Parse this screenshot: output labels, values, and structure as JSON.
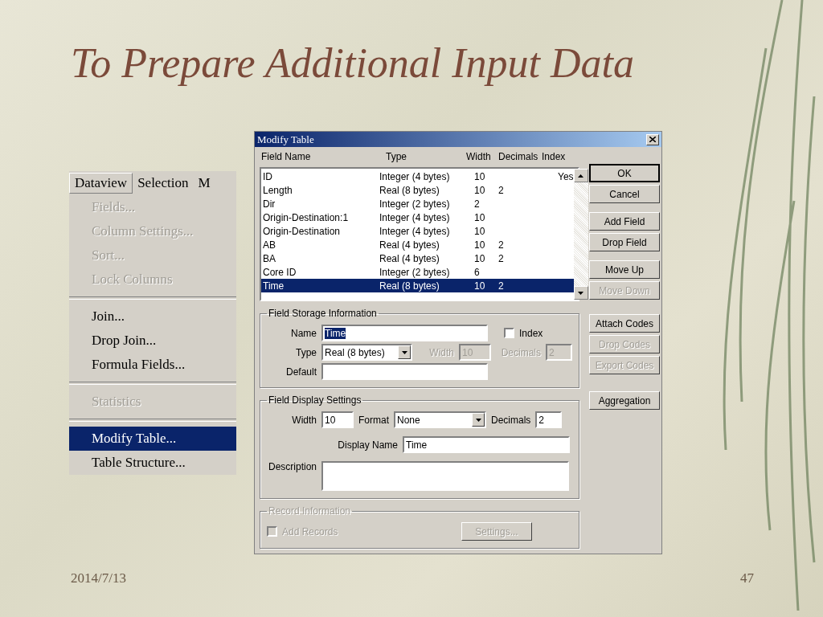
{
  "slide": {
    "title": "To Prepare Additional Input Data",
    "date": "2014/7/13",
    "page_number": "47"
  },
  "menu": {
    "menu_bar": [
      {
        "label": "Dataview",
        "selected": true
      },
      {
        "label": "Selection",
        "selected": false
      },
      {
        "label": "M",
        "selected": false
      }
    ],
    "items": [
      {
        "kind": "item",
        "label": "Fields...",
        "disabled": true,
        "selected": false
      },
      {
        "kind": "item",
        "label": "Column Settings...",
        "disabled": true,
        "selected": false
      },
      {
        "kind": "item",
        "label": "Sort...",
        "disabled": true,
        "selected": false
      },
      {
        "kind": "item",
        "label": "Lock Columns",
        "disabled": true,
        "selected": false
      },
      {
        "kind": "separator"
      },
      {
        "kind": "item",
        "label": "Join...",
        "disabled": false,
        "selected": false
      },
      {
        "kind": "item",
        "label": "Drop Join...",
        "disabled": false,
        "selected": false
      },
      {
        "kind": "item",
        "label": "Formula Fields...",
        "disabled": false,
        "selected": false
      },
      {
        "kind": "separator"
      },
      {
        "kind": "item",
        "label": "Statistics",
        "disabled": true,
        "selected": false
      },
      {
        "kind": "separator"
      },
      {
        "kind": "item",
        "label": "Modify Table...",
        "disabled": false,
        "selected": true
      },
      {
        "kind": "item",
        "label": "Table Structure...",
        "disabled": false,
        "selected": false
      }
    ]
  },
  "dialog": {
    "title": "Modify Table",
    "columns": [
      "Field Name",
      "Type",
      "Width",
      "Decimals",
      "Index"
    ],
    "rows": [
      {
        "cells": [
          "ID",
          "Integer (4 bytes)",
          "10",
          "",
          "Yes"
        ],
        "selected": false
      },
      {
        "cells": [
          "Length",
          "Real (8 bytes)",
          "10",
          "2",
          ""
        ],
        "selected": false
      },
      {
        "cells": [
          "Dir",
          "Integer (2 bytes)",
          "2",
          "",
          ""
        ],
        "selected": false
      },
      {
        "cells": [
          "Origin-Destination:1",
          "Integer (4 bytes)",
          "10",
          "",
          ""
        ],
        "selected": false
      },
      {
        "cells": [
          "Origin-Destination",
          "Integer (4 bytes)",
          "10",
          "",
          ""
        ],
        "selected": false
      },
      {
        "cells": [
          "AB",
          "Real (4 bytes)",
          "10",
          "2",
          ""
        ],
        "selected": false
      },
      {
        "cells": [
          "BA",
          "Real (4 bytes)",
          "10",
          "2",
          ""
        ],
        "selected": false
      },
      {
        "cells": [
          "Core ID",
          "Integer (2 bytes)",
          "6",
          "",
          ""
        ],
        "selected": false
      },
      {
        "cells": [
          "Time",
          "Real (8 bytes)",
          "10",
          "2",
          ""
        ],
        "selected": true
      }
    ],
    "button_groups": [
      [
        {
          "label": "OK",
          "disabled": false,
          "default": true
        },
        {
          "label": "Cancel",
          "disabled": false,
          "default": false
        }
      ],
      [
        {
          "label": "Add Field",
          "disabled": false,
          "default": false
        },
        {
          "label": "Drop Field",
          "disabled": false,
          "default": false
        }
      ],
      [
        {
          "label": "Move Up",
          "disabled": false,
          "default": false
        },
        {
          "label": "Move Down",
          "disabled": true,
          "default": false
        }
      ],
      [
        {
          "label": "Attach Codes",
          "disabled": false,
          "default": false
        },
        {
          "label": "Drop Codes",
          "disabled": true,
          "default": false
        },
        {
          "label": "Export Codes",
          "disabled": true,
          "default": false
        }
      ],
      [
        {
          "label": "Aggregation",
          "disabled": false,
          "default": false
        }
      ]
    ],
    "storage": {
      "legend": "Field Storage Information",
      "name": {
        "label": "Name",
        "value": "Time",
        "highlighted": true
      },
      "index": {
        "label": "Index",
        "checked": false
      },
      "type": {
        "label": "Type",
        "value": "Real (8 bytes)"
      },
      "width": {
        "label": "Width",
        "value": "10",
        "disabled": true
      },
      "decimals": {
        "label": "Decimals",
        "value": "2",
        "disabled": true
      },
      "default": {
        "label": "Default"
      }
    },
    "display": {
      "legend": "Field Display Settings",
      "width": {
        "label": "Width",
        "value": "10"
      },
      "format": {
        "label": "Format",
        "value": "None"
      },
      "decimals": {
        "label": "Decimals",
        "value": "2"
      },
      "display_name": {
        "label": "Display Name",
        "value": "Time"
      },
      "description": {
        "label": "Description"
      }
    },
    "record": {
      "legend": "Record Information",
      "disabled": true,
      "add_records": {
        "label": "Add Records",
        "checked": false,
        "disabled": true
      },
      "settings": {
        "label": "Settings...",
        "disabled": true
      }
    }
  }
}
